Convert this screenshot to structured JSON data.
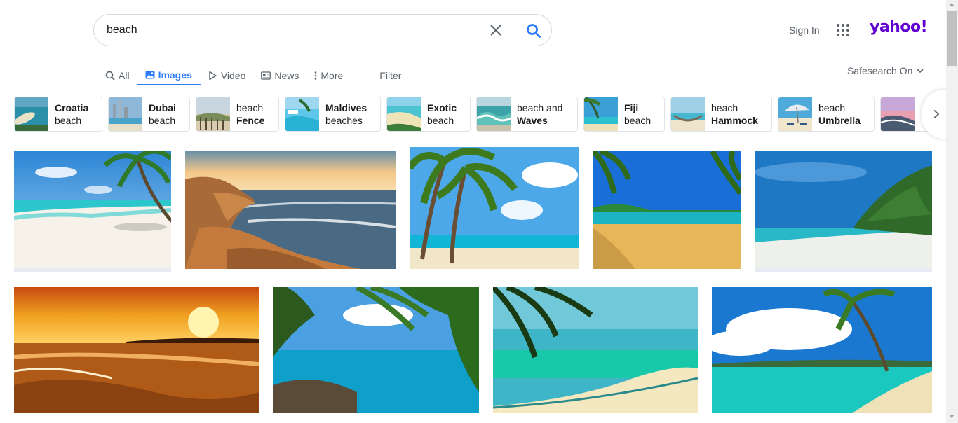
{
  "search": {
    "query": "beach"
  },
  "header": {
    "sign_in": "Sign In",
    "logo": "yahoo!"
  },
  "tabs": [
    {
      "label": "All",
      "icon": "search-icon",
      "active": false
    },
    {
      "label": "Images",
      "icon": "image-icon",
      "active": true
    },
    {
      "label": "Video",
      "icon": "play-icon",
      "active": false
    },
    {
      "label": "News",
      "icon": "news-icon",
      "active": false
    },
    {
      "label": "More",
      "icon": "more-vertical-icon",
      "active": false
    }
  ],
  "filter_label": "Filter",
  "safesearch_label": "Safesearch On",
  "related": [
    {
      "line1": "Croatia",
      "line2": "beach",
      "bold": 1
    },
    {
      "line1": "Dubai",
      "line2": "beach",
      "bold": 1
    },
    {
      "line1": "beach",
      "line2": "Fence",
      "bold": 2
    },
    {
      "line1": "Maldives",
      "line2": "beaches",
      "bold": 1
    },
    {
      "line1": "Exotic",
      "line2": "beach",
      "bold": 1
    },
    {
      "line1": "beach and",
      "line2": "Waves",
      "bold": 3
    },
    {
      "line1": "Fiji",
      "line2": "beach",
      "bold": 1
    },
    {
      "line1": "beach",
      "line2": "Hammock",
      "bold": 2
    },
    {
      "line1": "beach",
      "line2": "Umbrella",
      "bold": 2
    }
  ],
  "colors": {
    "accent": "#2e7cf6",
    "logo": "#6001d2",
    "text_muted": "#5b636a"
  }
}
